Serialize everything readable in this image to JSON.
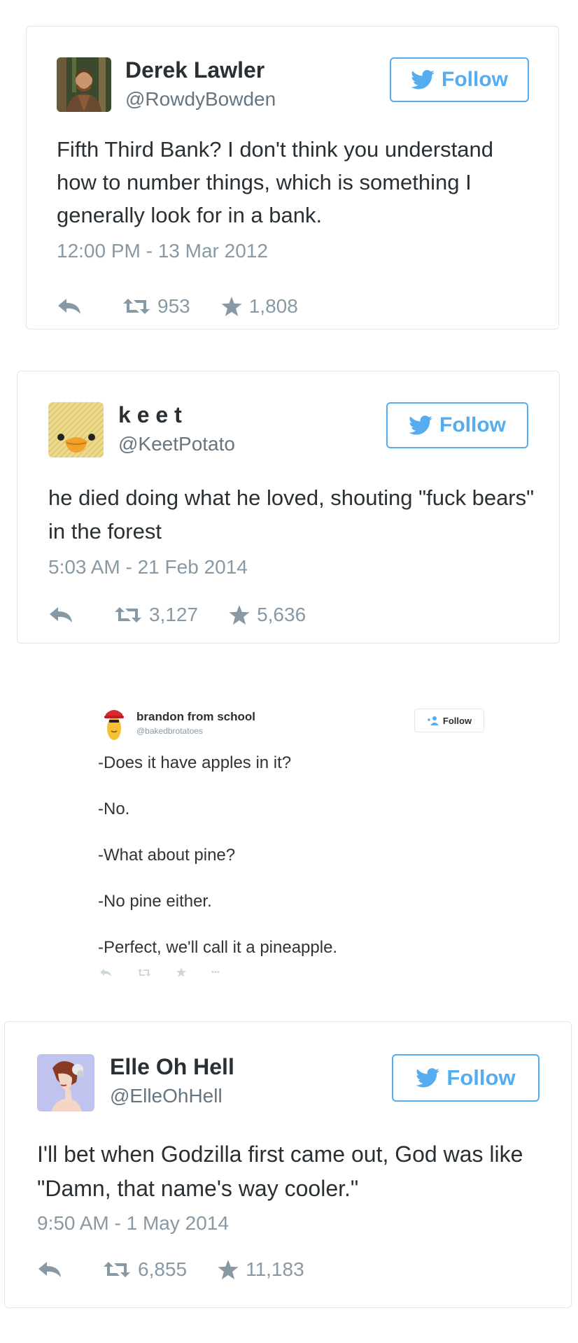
{
  "tweets": [
    {
      "name": "Derek Lawler",
      "handle": "@RowdyBowden",
      "follow_label": "Follow",
      "text": "Fifth Third Bank? I don't think you understand how to number things, which is something I generally look for in a bank.",
      "timestamp": "12:00 PM - 13 Mar 2012",
      "retweets": "953",
      "favorites": "1,808",
      "avatar_icon": "photo-avatar"
    },
    {
      "name": "k e e t",
      "handle": "@KeetPotato",
      "follow_label": "Follow",
      "text": "he died doing what he loved, shouting \"fuck bears\" in the forest",
      "timestamp": "5:03 AM - 21 Feb 2014",
      "retweets": "3,127",
      "favorites": "5,636",
      "avatar_icon": "duck-avatar"
    },
    {
      "name": "Elle Oh Hell",
      "handle": "@ElleOhHell",
      "follow_label": "Follow",
      "text": "I'll bet when Godzilla first came out, God was like \"Damn, that name's way cooler.\"",
      "timestamp": "9:50 AM - 1 May 2014",
      "retweets": "6,855",
      "favorites": "11,183",
      "avatar_icon": "illustrated-woman-avatar"
    }
  ],
  "small_tweet": {
    "name": "brandon from school",
    "handle": "@bakedbrotatoes",
    "follow_label": "Follow",
    "lines": [
      "-Does it have apples in it?",
      "-No.",
      "-What about pine?",
      "-No pine either.",
      "-Perfect, we'll call it a pineapple."
    ],
    "more_glyph": "•••"
  },
  "colors": {
    "twitter_blue": "#55acee",
    "border": "#e1e8ed",
    "muted": "#8899a6",
    "text": "#292f33"
  }
}
